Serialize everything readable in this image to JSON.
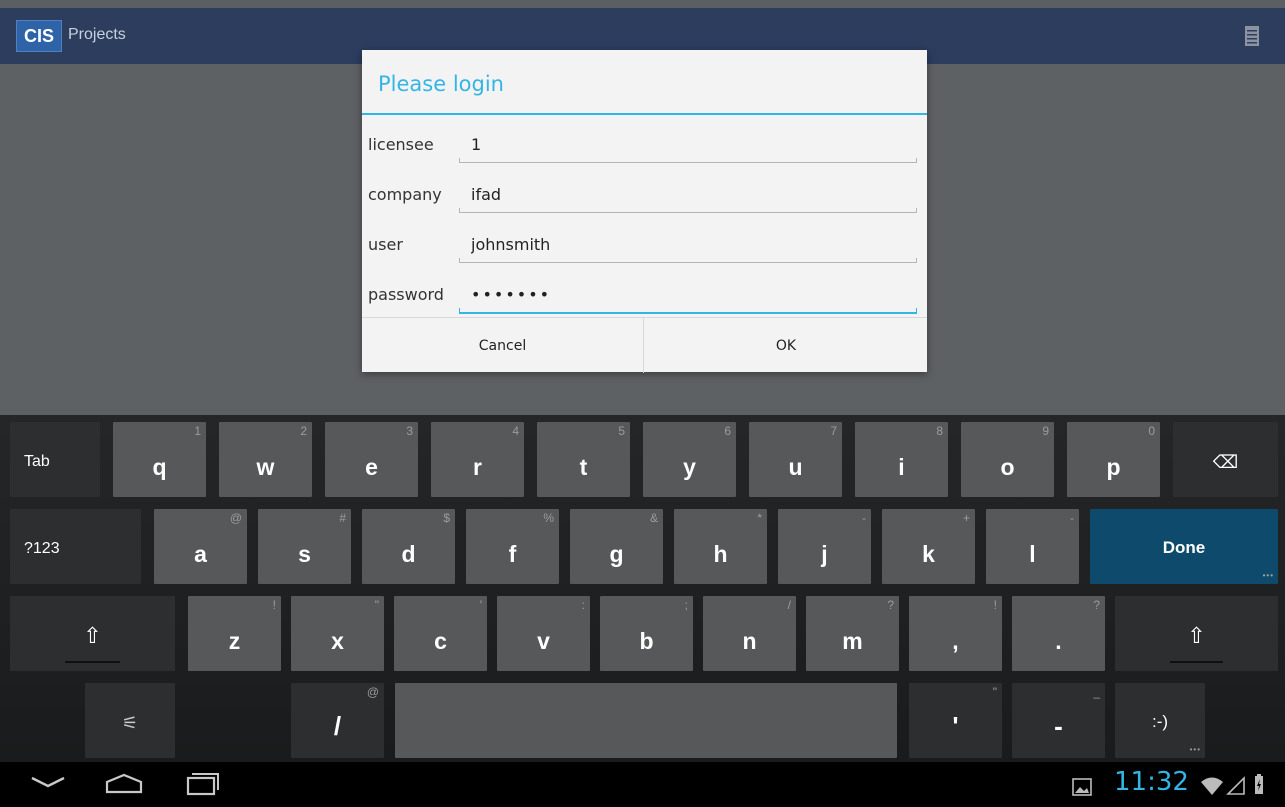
{
  "actionbar": {
    "logo": "CIS",
    "title": "Projects"
  },
  "dialog": {
    "title": "Please login",
    "fields": [
      {
        "label": "licensee",
        "value": "1"
      },
      {
        "label": "company",
        "value": "ifad"
      },
      {
        "label": "user",
        "value": "johnsmith"
      },
      {
        "label": "password",
        "value": "•••••••"
      }
    ],
    "buttons": {
      "cancel": "Cancel",
      "ok": "OK"
    }
  },
  "keyboard": {
    "row1": [
      {
        "main": "Tab",
        "hint": ""
      },
      {
        "main": "q",
        "hint": "1"
      },
      {
        "main": "w",
        "hint": "2"
      },
      {
        "main": "e",
        "hint": "3"
      },
      {
        "main": "r",
        "hint": "4"
      },
      {
        "main": "t",
        "hint": "5"
      },
      {
        "main": "y",
        "hint": "6"
      },
      {
        "main": "u",
        "hint": "7"
      },
      {
        "main": "i",
        "hint": "8"
      },
      {
        "main": "o",
        "hint": "9"
      },
      {
        "main": "p",
        "hint": "0"
      },
      {
        "main": "⌫",
        "hint": ""
      }
    ],
    "row2": [
      {
        "main": "?123",
        "hint": ""
      },
      {
        "main": "a",
        "hint": "@"
      },
      {
        "main": "s",
        "hint": "#"
      },
      {
        "main": "d",
        "hint": "$"
      },
      {
        "main": "f",
        "hint": "%"
      },
      {
        "main": "g",
        "hint": "&"
      },
      {
        "main": "h",
        "hint": "*"
      },
      {
        "main": "j",
        "hint": "-"
      },
      {
        "main": "k",
        "hint": "+"
      },
      {
        "main": "l",
        "hint": "-"
      },
      {
        "main": "Done",
        "hint": ""
      }
    ],
    "row3": [
      {
        "main": "⇧",
        "hint": ""
      },
      {
        "main": "z",
        "hint": "!"
      },
      {
        "main": "x",
        "hint": "\""
      },
      {
        "main": "c",
        "hint": "'"
      },
      {
        "main": "v",
        "hint": ":"
      },
      {
        "main": "b",
        "hint": ";"
      },
      {
        "main": "n",
        "hint": "/"
      },
      {
        "main": "m",
        "hint": "?"
      },
      {
        "main": ",",
        "hint": "!"
      },
      {
        "main": ".",
        "hint": "?"
      },
      {
        "main": "⇧",
        "hint": ""
      }
    ],
    "row4": [
      {
        "main": "⚟",
        "hint": ""
      },
      {
        "main": "/",
        "hint": "@"
      },
      {
        "main": "",
        "hint": ""
      },
      {
        "main": "'",
        "hint": "\""
      },
      {
        "main": "-",
        "hint": "_"
      },
      {
        "main": ":-)",
        "hint": ""
      }
    ]
  },
  "statusbar": {
    "time": "11:32"
  }
}
